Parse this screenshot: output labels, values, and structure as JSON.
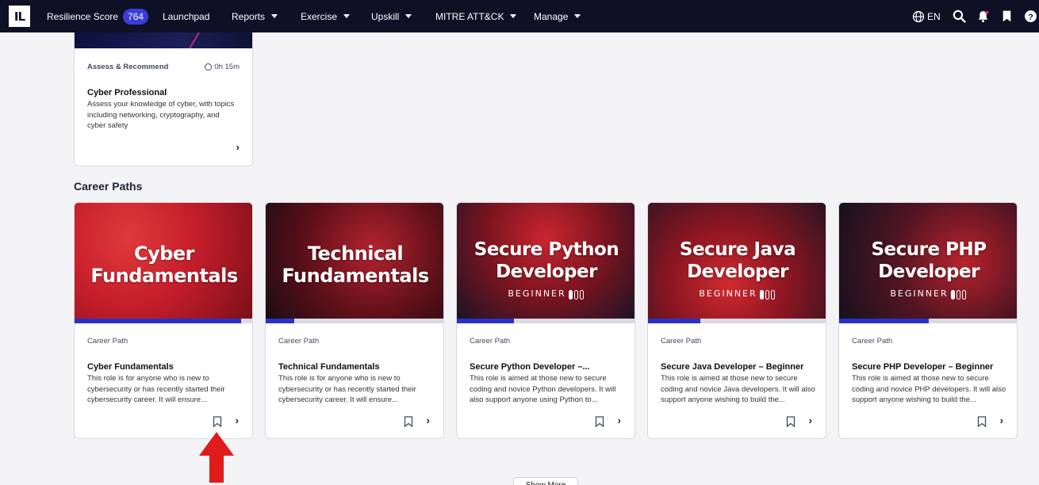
{
  "nav": {
    "logo": "IL",
    "resilience_label": "Resilience Score",
    "resilience_score": "764",
    "items": [
      {
        "label": "Launchpad",
        "dropdown": false
      },
      {
        "label": "Reports",
        "dropdown": true
      },
      {
        "label": "Exercise",
        "dropdown": true
      },
      {
        "label": "Upskill",
        "dropdown": true
      },
      {
        "label": "MITRE ATT&CK",
        "dropdown": true
      },
      {
        "label": "Manage",
        "dropdown": true
      }
    ],
    "language": "EN",
    "icons": [
      "globe-icon",
      "search-icon",
      "bell-icon",
      "bookmark-icon",
      "help-icon"
    ]
  },
  "top_card": {
    "category": "Assess & Recommend",
    "duration": "0h 15m",
    "title": "Cyber Professional",
    "description": "Assess your knowledge of cyber, with topics including networking, cryptography, and cyber safety"
  },
  "career_paths": {
    "section_title": "Career Paths",
    "cards": [
      {
        "art_title_line1": "Cyber",
        "art_title_line2": "Fundamentals",
        "art_level": "",
        "progress": 0.93,
        "category": "Career Path",
        "title": "Cyber Fundamentals",
        "description": "This role is for anyone who is new to cybersecurity or has recently started their cybersecurity career. It will ensure..."
      },
      {
        "art_title_line1": "Technical",
        "art_title_line2": "Fundamentals",
        "art_level": "",
        "progress": 0.16,
        "category": "Career Path",
        "title": "Technical Fundamentals",
        "description": "This role is for anyone who is new to cybersecurity or has recently started their cybersecurity career. It will ensure..."
      },
      {
        "art_title_line1": "Secure Python",
        "art_title_line2": "Developer",
        "art_level": "BEGINNER",
        "progress": 0.32,
        "category": "Career Path",
        "title": "Secure Python Developer –...",
        "description": "This role is aimed at those new to secure coding and novice Python developers. It will also support anyone using Python to..."
      },
      {
        "art_title_line1": "Secure Java",
        "art_title_line2": "Developer",
        "art_level": "BEGINNER",
        "progress": 0.29,
        "category": "Career Path",
        "title": "Secure Java Developer – Beginner",
        "description": "This role is aimed at those new to secure coding and novice Java developers. It will also support anyone wishing to build the..."
      },
      {
        "art_title_line1": "Secure PHP",
        "art_title_line2": "Developer",
        "art_level": "BEGINNER",
        "progress": 0.5,
        "category": "Career Path",
        "title": "Secure PHP Developer – Beginner",
        "description": "This role is aimed at those new to secure coding and novice PHP developers. It will also support anyone wishing to build the..."
      }
    ]
  },
  "show_more_label": "Show More",
  "colors": {
    "nav_bg": "#0e1126",
    "accent": "#2832c8",
    "badge": "#3b3dd6",
    "card_art_red": "#d4222f",
    "annotation_arrow": "#e01b1b"
  }
}
